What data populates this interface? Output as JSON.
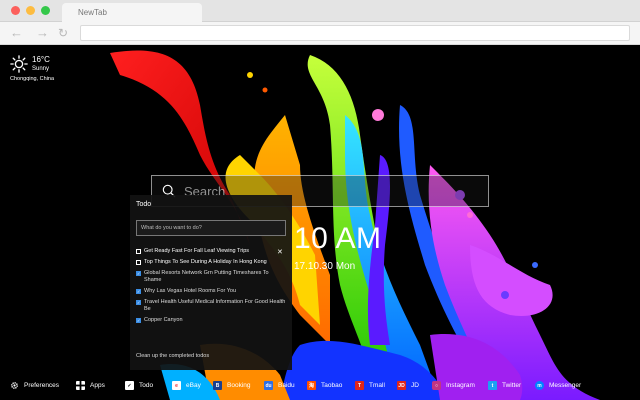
{
  "browser": {
    "tab_title": "NewTab"
  },
  "weather": {
    "temperature": "16°C",
    "condition": "Sunny",
    "location": "Chongqing,  China"
  },
  "search": {
    "placeholder": "Search"
  },
  "todo": {
    "title": "Todo",
    "input_placeholder": "What do you want to do?",
    "items": [
      {
        "text": "Get Ready Fast For Fall Leaf Viewing Trips",
        "done": false
      },
      {
        "text": "Top Things To See During A Holiday In Hong Kong",
        "done": false
      },
      {
        "text": "Global Resorts Network Grn Putting Timeshares To Shame",
        "done": true
      },
      {
        "text": "Why Las Vegas Hotel Rooms For You",
        "done": true
      },
      {
        "text": "Travel Health Useful Medical Information For Good Health Be",
        "done": true
      },
      {
        "text": "Copper Canyon",
        "done": true
      }
    ],
    "clear_label": "Clean up the completed todos"
  },
  "clock": {
    "time": "10 AM",
    "date": "17.10.30 Mon"
  },
  "bottom_bar": {
    "items": [
      {
        "label": "Preferences",
        "icon": "gear-icon",
        "color": "#000000"
      },
      {
        "label": "Apps",
        "icon": "grid-icon",
        "color": "#000000"
      },
      {
        "label": "Todo",
        "icon": "checkbox-icon",
        "color": "#ffffff"
      },
      {
        "label": "eBay",
        "icon": "ebay-icon",
        "color": "#ffffff"
      },
      {
        "label": "Booking",
        "icon": "booking-icon",
        "color": "#1a3f8f"
      },
      {
        "label": "Baidu",
        "icon": "baidu-icon",
        "color": "#2f6fe4"
      },
      {
        "label": "Taobao",
        "icon": "taobao-icon",
        "color": "#ff5000"
      },
      {
        "label": "Tmall",
        "icon": "tmall-icon",
        "color": "#e1251b"
      },
      {
        "label": "JD",
        "icon": "jd-icon",
        "color": "#e1251b"
      },
      {
        "label": "Instagram",
        "icon": "instagram-icon",
        "color": "#c13584"
      },
      {
        "label": "Twitter",
        "icon": "twitter-icon",
        "color": "#1da1f2"
      },
      {
        "label": "Messenger",
        "icon": "messenger-icon",
        "color": "#0084ff"
      }
    ]
  }
}
